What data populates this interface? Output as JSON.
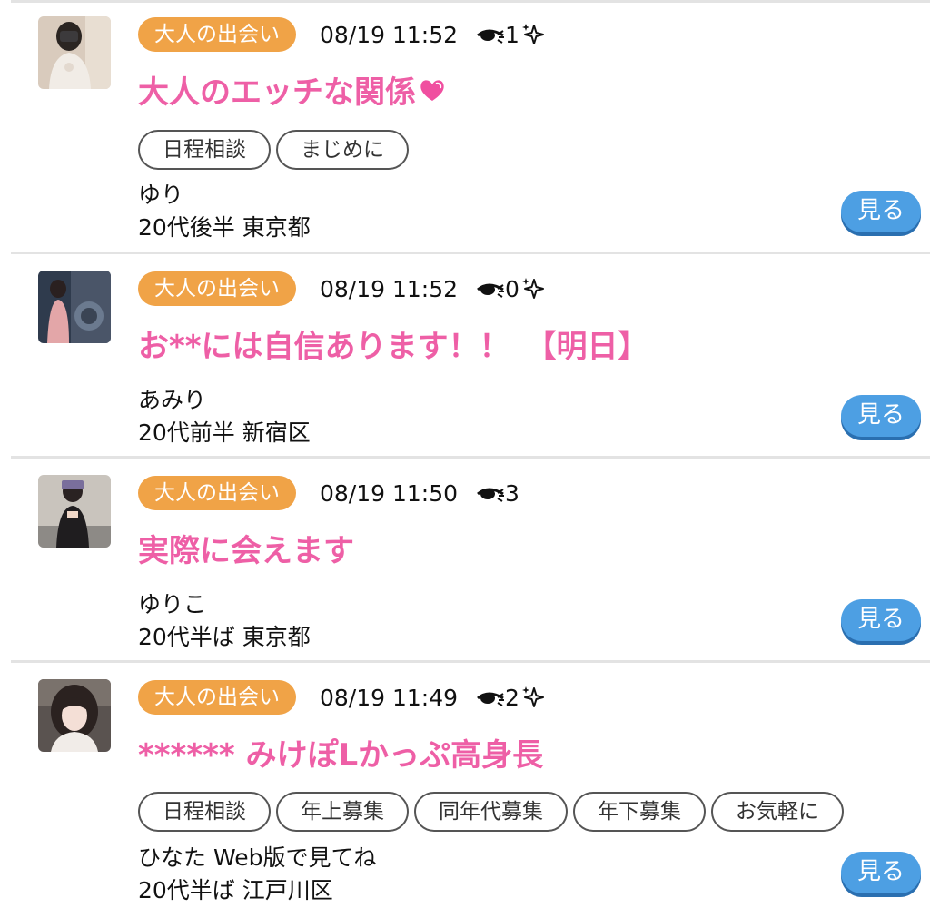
{
  "posts": [
    {
      "category": "大人の出会い",
      "datetime": "08/19 11:52",
      "views": "1",
      "sparkle": true,
      "title": "大人のエッチな関係",
      "title_emoji": "heart-icon",
      "tags": [
        "日程相談",
        "まじめに"
      ],
      "name": "ゆり",
      "profile": "20代後半 東京都",
      "view_button": "見る"
    },
    {
      "category": "大人の出会い",
      "datetime": "08/19 11:52",
      "views": "0",
      "sparkle": true,
      "title": "お**には自信あります！！　【明日】",
      "tags": [],
      "name": "あみり",
      "profile": "20代前半 新宿区",
      "view_button": "見る"
    },
    {
      "category": "大人の出会い",
      "datetime": "08/19 11:50",
      "views": "3",
      "sparkle": false,
      "title": "実際に会えます",
      "tags": [],
      "name": "ゆりこ",
      "profile": "20代半ば 東京都",
      "view_button": "見る"
    },
    {
      "category": "大人の出会い",
      "datetime": "08/19 11:49",
      "views": "2",
      "sparkle": true,
      "title": "****** みけぽLかっぷ高身長",
      "tags": [
        "日程相談",
        "年上募集",
        "同年代募集",
        "年下募集",
        "お気軽に"
      ],
      "name": "ひなた Web版で見てね",
      "profile": "20代半ば 江戸川区",
      "view_button": "見る"
    }
  ],
  "colors": {
    "category_badge": "#f0a347",
    "title": "#ee5fa6",
    "view_button": "#4d9fe3",
    "separator": "#e3e3e3"
  }
}
